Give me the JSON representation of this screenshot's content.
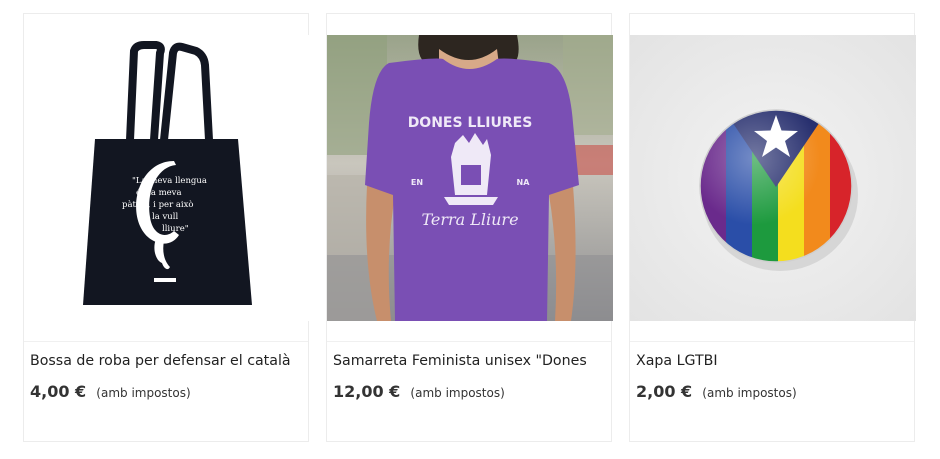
{
  "products": [
    {
      "title": "Bossa de roba per defensar el català",
      "price": "4,00 €",
      "tax_note": "(amb impostos)",
      "image": {
        "icon": "tote-bag-image",
        "quote_lines": [
          "\"La meva llengua",
          "és la meva",
          "pàtria, i per això",
          "la vull",
          "lliure\""
        ],
        "background": "#ffffff",
        "bag_color": "#121621"
      }
    },
    {
      "title": "Samarreta Feminista unisex \"Dones",
      "price": "12,00 €",
      "tax_note": "(amb impostos)",
      "image": {
        "icon": "purple-tshirt-image",
        "print_top": "DONES LLIURES",
        "print_mid_left": "EN",
        "print_mid_right": "NA",
        "print_bottom": "Terra Lliure",
        "shirt_color": "#7a4fb4"
      }
    },
    {
      "title": "Xapa LGTBI",
      "price": "2,00 €",
      "tax_note": "(amb impostos)",
      "image": {
        "icon": "rainbow-badge-image",
        "background": "#ebebeb",
        "triangle_color": "#28306f",
        "star_color": "#ffffff"
      }
    }
  ]
}
